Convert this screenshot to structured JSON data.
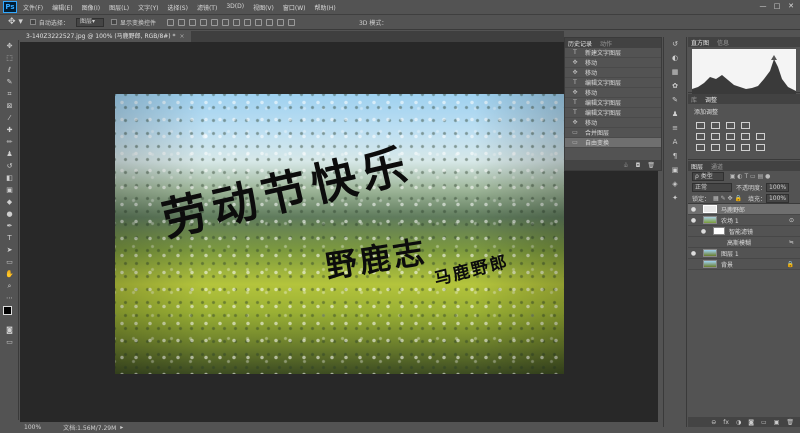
{
  "app": {
    "logo": "Ps"
  },
  "menu": [
    "文件(F)",
    "编辑(E)",
    "图像(I)",
    "图层(L)",
    "文字(Y)",
    "选择(S)",
    "滤镜(T)",
    "3D(D)",
    "视图(V)",
    "窗口(W)",
    "帮助(H)"
  ],
  "window_controls": [
    "—",
    "□",
    "✕"
  ],
  "options": {
    "tool_icon": "move-icon",
    "auto_select_label": "自动选择：",
    "auto_select_value": "图层",
    "show_transform_label": "显示变换控件",
    "three_d_label": "3D 模式："
  },
  "document": {
    "tab_title": "3-140Z3222527.jpg @ 100% (马鹿野郎, RGB/8#) *",
    "close": "×"
  },
  "canvas_text": {
    "title": "劳动节快乐",
    "subtitle": "野鹿志",
    "signature": "马鹿野郎"
  },
  "history": {
    "tabs": [
      "历史记录",
      "动作"
    ],
    "rows": [
      {
        "icon": "T",
        "label": "新建文字图层"
      },
      {
        "icon": "✥",
        "label": "移动"
      },
      {
        "icon": "✥",
        "label": "移动"
      },
      {
        "icon": "T",
        "label": "编辑文字图层"
      },
      {
        "icon": "✥",
        "label": "移动"
      },
      {
        "icon": "T",
        "label": "编辑文字图层"
      },
      {
        "icon": "T",
        "label": "编辑文字图层"
      },
      {
        "icon": "✥",
        "label": "移动"
      },
      {
        "icon": "▭",
        "label": "合并图层"
      },
      {
        "icon": "▭",
        "label": "自由变换"
      }
    ],
    "footer_icons": [
      "♧",
      "◘",
      "🗑"
    ]
  },
  "histogram_panel": {
    "tabs": [
      "直方图",
      "信息"
    ]
  },
  "adjustments_panel": {
    "tabs": [
      "库",
      "调整"
    ],
    "heading": "添加调整"
  },
  "layers": {
    "tabs": [
      "图层",
      "通道"
    ],
    "kind_filter": "ρ 类型",
    "blend_mode": "正常",
    "opacity_label": "不透明度：",
    "opacity_value": "100%",
    "lock_label": "锁定：",
    "fill_label": "填充：",
    "fill_value": "100%",
    "rows": [
      {
        "name": "马鹿野郎",
        "visible": "●",
        "extra": ""
      },
      {
        "name": "农场 1",
        "visible": "●",
        "extra": "⊙"
      },
      {
        "name": "智能滤镜",
        "visible": "●",
        "extra": ""
      },
      {
        "name": "高斯模糊",
        "visible": "",
        "extra": "≒"
      },
      {
        "name": "图层 1",
        "visible": "●",
        "extra": ""
      },
      {
        "name": "背景",
        "visible": "",
        "extra": "🔒"
      }
    ],
    "footer_icons": [
      "⊖",
      "fx",
      "◑",
      "◙",
      "▭",
      "▣",
      "🗑"
    ]
  },
  "status": {
    "zoom": "100%",
    "doc_size": "文档:1.56M/7.29M",
    "arrow": "▸"
  }
}
